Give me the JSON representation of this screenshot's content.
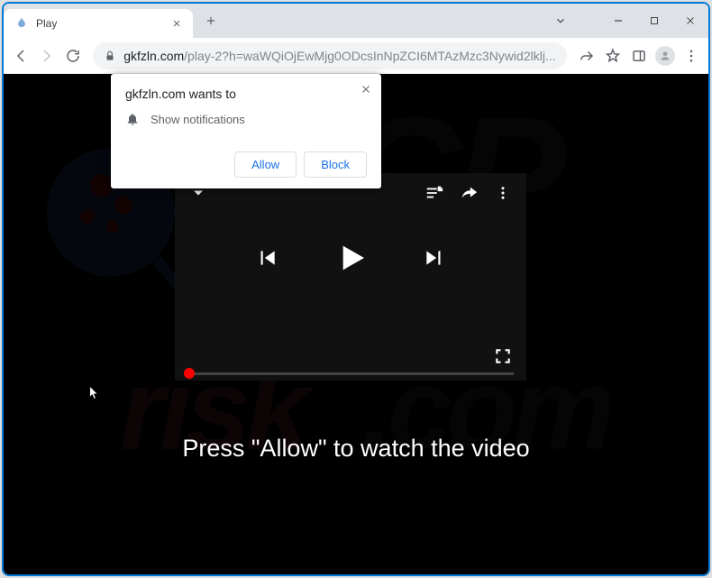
{
  "window": {
    "tab_title": "Play",
    "url_domain": "gkfzln.com",
    "url_path": "/play-2?h=waWQiOjEwMjg0ODcsInNpZCI6MTAzMzc3Nywid2lklj..."
  },
  "notification": {
    "title": "gkfzln.com wants to",
    "line1": "Show notifications",
    "allow": "Allow",
    "block": "Block"
  },
  "page": {
    "cta": "Press \"Allow\" to watch the video"
  },
  "watermark": {
    "top": "PCP",
    "bottom": "risk.com"
  }
}
